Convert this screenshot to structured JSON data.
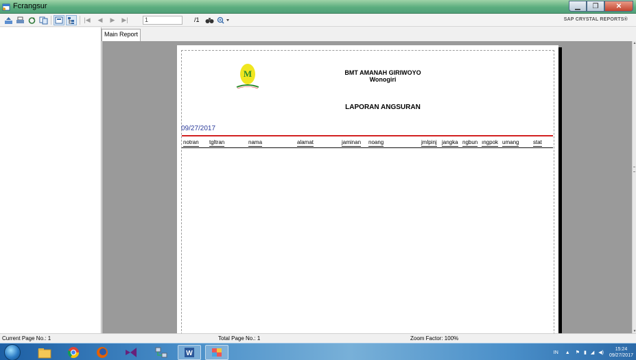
{
  "window": {
    "title": "Fcrangsur",
    "icon": "form-icon",
    "controls": {
      "minimize": "minimize-icon",
      "maximize": "maximize-icon",
      "close": "close-icon"
    }
  },
  "toolbar": {
    "buttons": [
      {
        "name": "export-icon"
      },
      {
        "name": "print-icon"
      },
      {
        "name": "refresh-icon"
      },
      {
        "name": "copy-icon"
      },
      {
        "name": "toggle-parameter-panel-icon"
      },
      {
        "name": "toggle-group-tree-icon"
      }
    ],
    "nav": {
      "first": "first-page-icon",
      "prev": "previous-page-icon",
      "next": "next-page-icon",
      "last": "last-page-icon"
    },
    "page_input": "1",
    "page_total": "/1",
    "find_icon": "binoculars-icon",
    "zoom_icon": "zoom-icon",
    "brand": "SAP CRYSTAL REPORTS®"
  },
  "tabs": [
    "Main Report"
  ],
  "report": {
    "company": "BMT AMANAH GIRIWOYO",
    "city": "Wonogiri",
    "report_title": "LAPORAN ANGSURAN",
    "date": "09/27/2017",
    "columns": [
      "notran",
      "tgltran",
      "nama",
      "alamat",
      "jaminan",
      "noang",
      "jmlpinj",
      "jangka",
      "ngbun",
      "ıngpok",
      "umang",
      "stat"
    ],
    "accent_color": "#d21f1f",
    "date_color": "#2a3a9a"
  },
  "statusbar": {
    "current_page": "Current Page No.: 1",
    "total_page": "Total Page No.: 1",
    "zoom": "Zoom Factor: 100%"
  },
  "taskbar": {
    "apps": [
      "windows-start-icon",
      "file-explorer-icon",
      "chrome-icon",
      "firefox-icon",
      "visual-studio-icon",
      "network-icon",
      "word-icon",
      "app-icon"
    ],
    "tray_lang": "IN",
    "time": "15:24",
    "date": "09/27/2017"
  }
}
